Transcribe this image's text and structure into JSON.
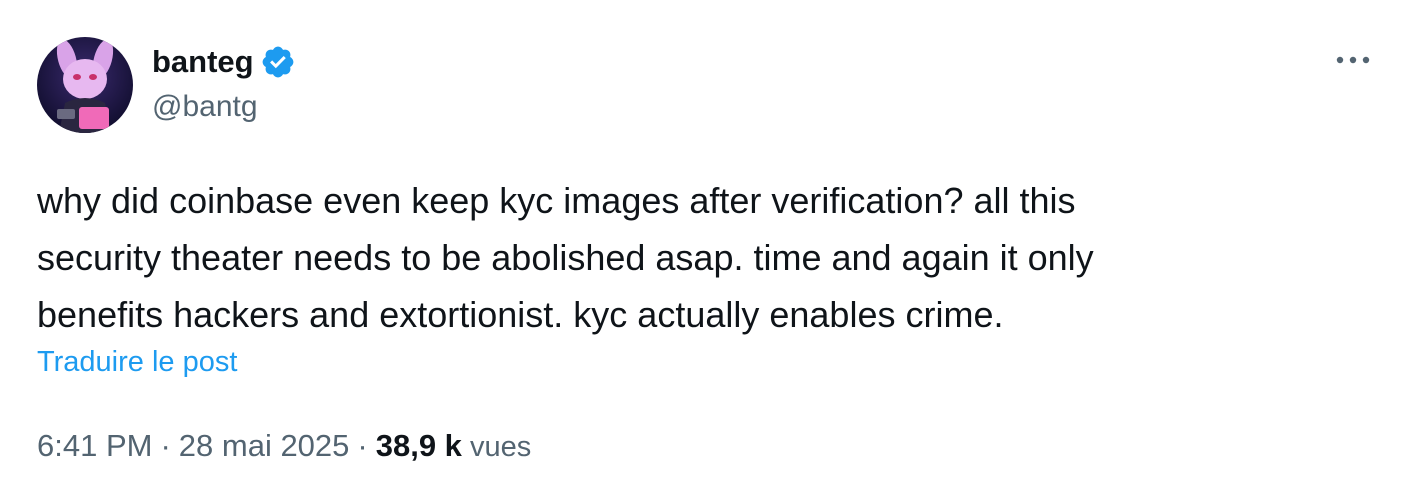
{
  "user": {
    "display_name": "banteg",
    "handle": "@bantg",
    "verified": true,
    "avatar_icon": "avatar-image"
  },
  "more_icon": "more-horizontal-icon",
  "tweet": {
    "text": "why did coinbase even keep kyc images after verification? all this\nsecurity theater needs to be abolished asap. time and again it only\nbenefits hackers and extortionist. kyc actually enables crime.",
    "translate_label": "Traduire le post"
  },
  "meta": {
    "time": "6:41 PM",
    "separator": "·",
    "date": "28 mai 2025",
    "views_count": "38,9 k",
    "views_label": "vues"
  },
  "colors": {
    "link": "#1d9bf0",
    "verified": "#1d9bf0",
    "secondary_text": "#536471",
    "primary_text": "#0f1419"
  }
}
